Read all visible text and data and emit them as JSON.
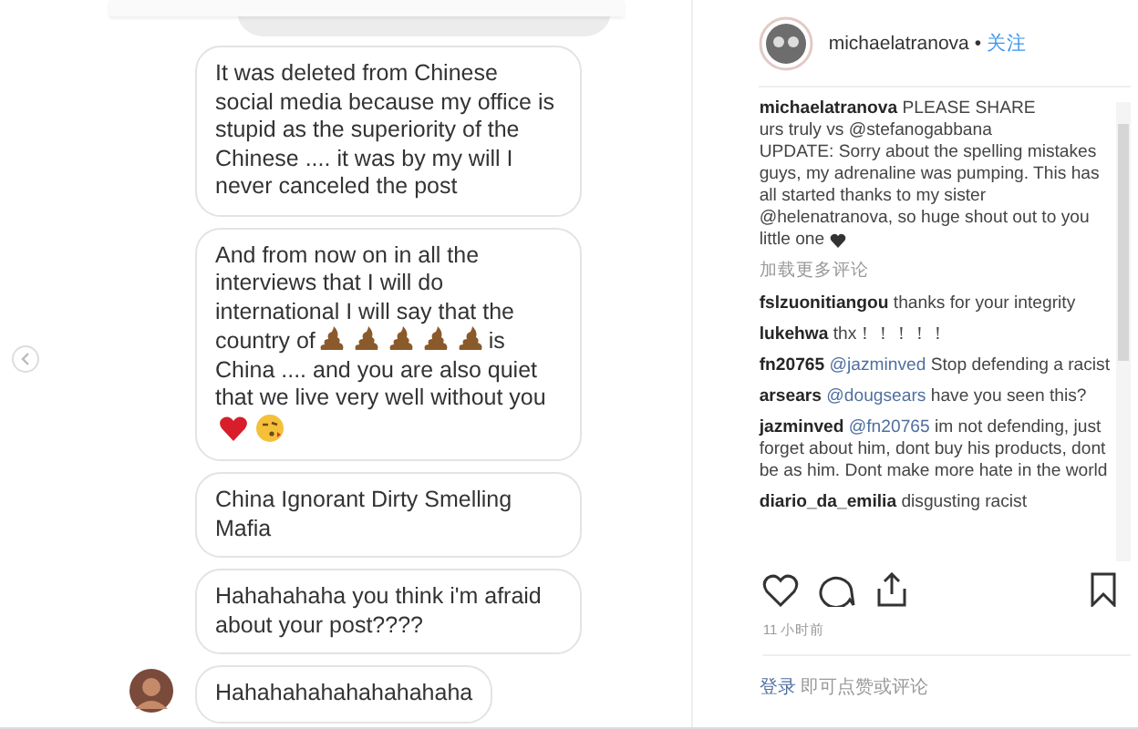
{
  "chat": {
    "messages": [
      {
        "parts": [
          {
            "kind": "text",
            "text": "It was deleted from Chinese social media because my office is stupid as the superiority of the Chinese .... it was by my will I never canceled the post"
          }
        ]
      },
      {
        "parts": [
          {
            "kind": "text",
            "text": "And from now on in all the interviews that I will do international I will say that the"
          },
          {
            "kind": "break"
          },
          {
            "kind": "text",
            "text": "country of"
          },
          {
            "kind": "poop-emoji"
          },
          {
            "kind": "poop-emoji"
          },
          {
            "kind": "poop-emoji"
          },
          {
            "kind": "poop-emoji"
          },
          {
            "kind": "poop-emoji"
          },
          {
            "kind": "text",
            "text": "is"
          },
          {
            "kind": "break"
          },
          {
            "kind": "text",
            "text": "China .... and you are also quiet that we live very well without you"
          },
          {
            "kind": "break"
          },
          {
            "kind": "heart-emoji"
          },
          {
            "kind": "kiss-emoji"
          }
        ]
      },
      {
        "parts": [
          {
            "kind": "text",
            "text": "China Ignorant Dirty Smelling Mafia"
          }
        ]
      },
      {
        "parts": [
          {
            "kind": "text",
            "text": "Hahahahaha you think i'm afraid about your post????"
          }
        ]
      },
      {
        "parts": [
          {
            "kind": "text",
            "text": "Hahahahahahahahahaha"
          }
        ],
        "avatar": true
      }
    ]
  },
  "post": {
    "username": "michaelatranova",
    "separator": "•",
    "follow": "关注",
    "caption": {
      "user": "michaelatranova",
      "lines": [
        "PLEASE SHARE",
        "urs truly vs @stefanogabbana",
        "UPDATE: Sorry about the spelling mistakes guys, my adrenaline was pumping. This has all started thanks to my sister @helenatranova, so huge shout out to you",
        "little one"
      ]
    },
    "load_more": "加载更多评论",
    "comments": [
      {
        "user": "fslzuonitiangou",
        "text": "thanks for your integrity"
      },
      {
        "user": "lukehwa",
        "text": "thx！！！！！"
      },
      {
        "user": "fn20765",
        "mention": "@jazminved",
        "text": "Stop defending a racist"
      },
      {
        "user": "arsears",
        "mention": "@dougsears",
        "text": "have you seen this?"
      },
      {
        "user": "jazminved",
        "mention": "@fn20765",
        "text": "im not defending, just forget about him, dont buy his products, dont be as him. Dont make more hate in the world"
      },
      {
        "user": "diario_da_emilia",
        "text": "disgusting racist"
      }
    ],
    "time": "11 小时前",
    "login_link": "登录",
    "login_text": "即可点赞或评论"
  }
}
